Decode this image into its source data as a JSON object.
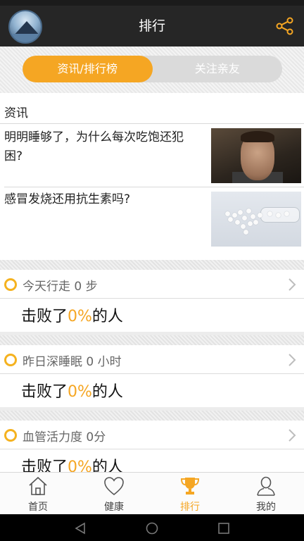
{
  "title_bar": {
    "title": "排行"
  },
  "segmented_tabs": [
    {
      "label": "资讯/排行榜",
      "active": true
    },
    {
      "label": "关注亲友",
      "active": false
    }
  ],
  "news": {
    "header": "资讯",
    "items": [
      {
        "title": "明明睡够了，为什么每次吃饱还犯困?"
      },
      {
        "title": "感冒发烧还用抗生素吗?"
      }
    ]
  },
  "stats": [
    {
      "label": "今天行走 0 步",
      "result_prefix": "击败了",
      "result_value": "0%",
      "result_suffix": "的人"
    },
    {
      "label": "昨日深睡眠 0 小时",
      "result_prefix": "击败了",
      "result_value": "0%",
      "result_suffix": "的人"
    },
    {
      "label": "血管活力度 0分",
      "result_prefix": "击败了",
      "result_value": "0%",
      "result_suffix": "的人"
    }
  ],
  "tab_bar": [
    {
      "label": "首页",
      "icon": "home-icon",
      "active": false
    },
    {
      "label": "健康",
      "icon": "heart-icon",
      "active": false
    },
    {
      "label": "排行",
      "icon": "trophy-icon",
      "active": true
    },
    {
      "label": "我的",
      "icon": "person-icon",
      "active": false
    }
  ],
  "colors": {
    "accent": "#f5a623",
    "header_bg": "#262626"
  }
}
